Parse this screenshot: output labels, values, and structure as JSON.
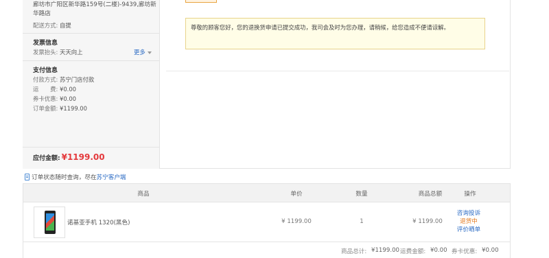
{
  "shipping": {
    "address": "廊坊市广阳区新华路159号(二楼)-9439,廊坊新华路店",
    "method_label": "配送方式:",
    "method_value": "自提"
  },
  "invoice": {
    "title": "发票信息",
    "header_label": "发票抬头:",
    "header_value": "天天向上",
    "more": "更多"
  },
  "payment": {
    "title": "支付信息",
    "method_label": "付款方式:",
    "method_value": "苏宁门店付款",
    "freight_label": "运　　费:",
    "freight_value": "¥0.00",
    "coupon_label": "券卡优惠:",
    "coupon_value": "¥0.00",
    "order_amount_label": "订单金额:",
    "order_amount_value": "¥1199.00",
    "due_label": "应付金额:",
    "due_value": "¥1199.00"
  },
  "notice": {
    "text": "尊敬的顾客您好，您的退换货申请已提交成功，我司会及时为您办理，请稍候，给您造成不便请谅解。"
  },
  "query": {
    "prefix": "订单状态随时查询，尽在",
    "link": "苏宁客户端"
  },
  "table": {
    "headers": {
      "product": "商品",
      "unit_price": "单价",
      "quantity": "数量",
      "total": "商品总额",
      "action": "操作"
    },
    "rows": [
      {
        "name": "诺基亚手机 1320(黑色)",
        "unit_price": "¥ 1199.00",
        "quantity": "1",
        "total": "¥ 1199.00",
        "action_consult": "咨询投诉",
        "status": "退货中",
        "action_review": "评价晒单"
      }
    ],
    "summary": {
      "goods_total_label": "商品总计:",
      "goods_total_value": "¥1199.00",
      "freight_label": "运费金额:",
      "freight_value": "¥0.00",
      "coupon_label": "券卡优惠:",
      "coupon_value": "¥0.00"
    }
  },
  "colors": {
    "link": "#2b6bc4",
    "price_red": "#e4393c",
    "status_orange": "#e47a1e",
    "notice_bg": "#fffde7"
  }
}
